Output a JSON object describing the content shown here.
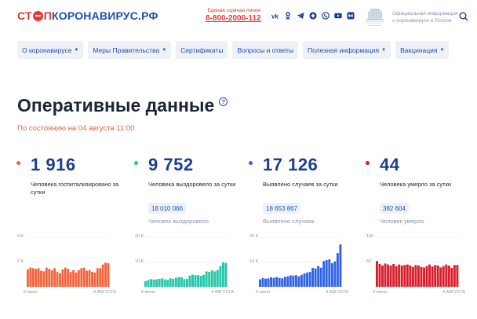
{
  "header": {
    "logo_stop": "СТ",
    "logo_stop2": "П",
    "logo_rest": "КОРОНАВИРУС.РФ",
    "hotline_caption": "Единая горячая линия",
    "hotline_number": "8-800-2000-112",
    "social_icons": [
      "vk-icon",
      "odnoklassniki-icon",
      "telegram-icon",
      "yandex-zen-icon",
      "viber-icon",
      "youtube-icon",
      "chat-icon"
    ],
    "official_line1": "Официальная информация",
    "official_line2": "о коронавирусе в России"
  },
  "nav": {
    "items": [
      {
        "label": "О коронавирусе",
        "dropdown": true
      },
      {
        "label": "Меры Правительства",
        "dropdown": true
      },
      {
        "label": "Сертификаты",
        "dropdown": false
      },
      {
        "label": "Вопросы и ответы",
        "dropdown": false
      },
      {
        "label": "Полезная информация",
        "dropdown": true
      },
      {
        "label": "Вакцинация",
        "dropdown": true
      }
    ]
  },
  "title": "Оперативные данные",
  "help_glyph": "?",
  "subtitle": "По состоянию на 04 августа 11:00",
  "stats": [
    {
      "value": "1 916",
      "desc": "Человека госпитализировано за сутки",
      "color": "#f2623a"
    },
    {
      "value": "9 752",
      "desc": "Человека выздоровело за сутки",
      "total": "18 010 066",
      "total_label": "Человек выздоровело",
      "color": "#21c7a8"
    },
    {
      "value": "17 126",
      "desc": "Выявлено случаев за сутки",
      "total": "18 653 867",
      "total_label": "Выявлено случаев",
      "color": "#2f63e6"
    },
    {
      "value": "44",
      "desc": "Человека умерло за сутки",
      "total": "382 604",
      "total_label": "Человек умерло",
      "color": "#d81e2c"
    }
  ],
  "chart_data": [
    {
      "type": "bar",
      "color": "#f2623a",
      "y_ticks": [
        "4 K",
        "2 K"
      ],
      "ylim": [
        0,
        4000
      ],
      "x_start": "5 июля",
      "x_end": "4 августа",
      "values": [
        1400,
        1550,
        1500,
        1450,
        1500,
        1300,
        1250,
        1550,
        1450,
        1350,
        1500,
        1200,
        1100,
        1400,
        1550,
        1450,
        1200,
        1350,
        1150,
        1350,
        1500,
        1550,
        1300,
        1350,
        1200,
        1150,
        1500,
        1500,
        1800,
        1950,
        1900
      ]
    },
    {
      "type": "bar",
      "color": "#21c7a8",
      "y_ticks": [
        "20 K",
        "10 K"
      ],
      "ylim": [
        0,
        20000
      ],
      "x_start": "6 июля",
      "x_end": "4 августа",
      "values": [
        2300,
        2700,
        3100,
        2900,
        3000,
        3200,
        3400,
        3000,
        2800,
        3400,
        3200,
        3600,
        3900,
        3900,
        3100,
        3200,
        4500,
        4900,
        4700,
        4700,
        4400,
        4800,
        6200,
        6000,
        6600,
        6200,
        6800,
        8400,
        9900,
        9600
      ]
    },
    {
      "type": "bar",
      "color": "#2f63e6",
      "y_ticks": [
        "20 K",
        "10 K"
      ],
      "ylim": [
        0,
        20000
      ],
      "x_start": "6 июля",
      "x_end": "4 августа",
      "values": [
        3000,
        3500,
        3300,
        3400,
        3800,
        3600,
        3900,
        3600,
        3400,
        4000,
        4200,
        4600,
        4500,
        4700,
        4200,
        4800,
        5400,
        5700,
        6000,
        7600,
        7400,
        8400,
        7700,
        10400,
        10800,
        11100,
        9500,
        10300,
        13600,
        17100
      ]
    },
    {
      "type": "bar",
      "color": "#d81e2c",
      "y_ticks": [
        "100",
        "50"
      ],
      "ylim": [
        0,
        100
      ],
      "x_start": "6 июля",
      "x_end": "4 августа",
      "values": [
        52,
        46,
        43,
        47,
        45,
        43,
        46,
        42,
        45,
        43,
        44,
        45,
        43,
        40,
        44,
        43,
        40,
        39,
        42,
        45,
        41,
        44,
        43,
        39,
        42,
        45,
        43,
        38,
        44,
        44
      ]
    }
  ]
}
